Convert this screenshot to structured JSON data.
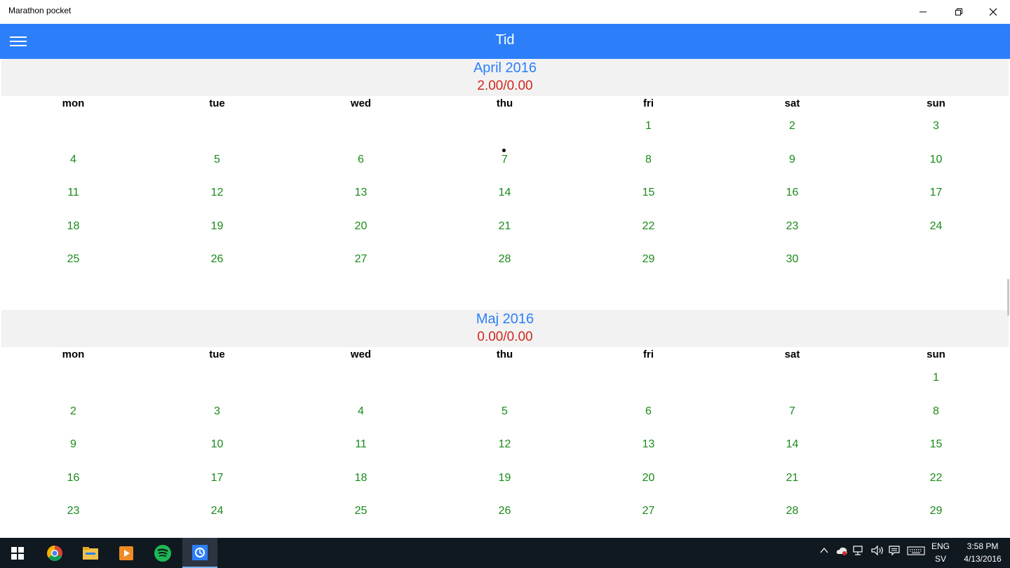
{
  "window": {
    "title": "Marathon pocket"
  },
  "appbar": {
    "title": "Tid"
  },
  "months": [
    {
      "name": "April 2016",
      "total": "2.00/0.00",
      "weekdays": [
        "mon",
        "tue",
        "wed",
        "thu",
        "fri",
        "sat",
        "sun"
      ],
      "weeks": [
        [
          "",
          "",
          "",
          "",
          "1",
          "2",
          "3"
        ],
        [
          "4",
          "5",
          "6",
          "7",
          "8",
          "9",
          "10"
        ],
        [
          "11",
          "12",
          "13",
          "14",
          "15",
          "16",
          "17"
        ],
        [
          "18",
          "19",
          "20",
          "21",
          "22",
          "23",
          "24"
        ],
        [
          "25",
          "26",
          "27",
          "28",
          "29",
          "30",
          ""
        ]
      ]
    },
    {
      "name": "Maj 2016",
      "total": "0.00/0.00",
      "weekdays": [
        "mon",
        "tue",
        "wed",
        "thu",
        "fri",
        "sat",
        "sun"
      ],
      "weeks": [
        [
          "",
          "",
          "",
          "",
          "",
          "",
          "1"
        ],
        [
          "2",
          "3",
          "4",
          "5",
          "6",
          "7",
          "8"
        ],
        [
          "9",
          "10",
          "11",
          "12",
          "13",
          "14",
          "15"
        ],
        [
          "16",
          "17",
          "18",
          "19",
          "20",
          "21",
          "22"
        ],
        [
          "23",
          "24",
          "25",
          "26",
          "27",
          "28",
          "29"
        ]
      ]
    }
  ],
  "taskbar": {
    "apps": [
      "chrome-icon",
      "file-explorer-icon",
      "media-player-icon",
      "spotify-icon",
      "marathon-pocket-icon"
    ],
    "language": "ENG",
    "layout": "SV",
    "time": "3:58 PM",
    "date": "4/13/2016"
  },
  "colors": {
    "accent": "#2d7ff9",
    "day_text": "#1a8a1a",
    "total_text": "#d0271d"
  }
}
